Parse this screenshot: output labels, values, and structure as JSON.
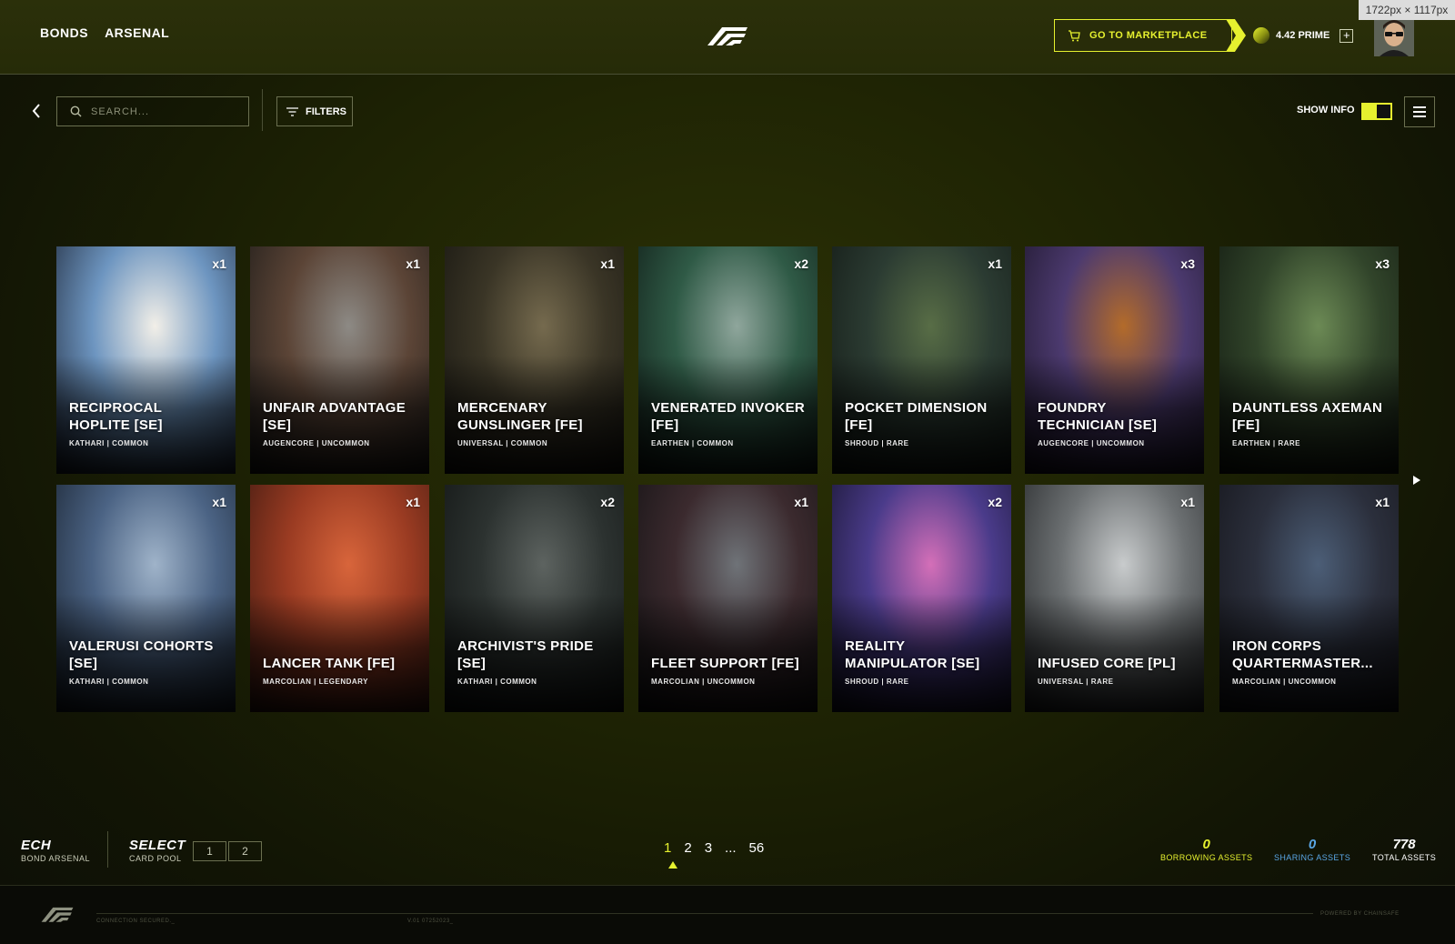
{
  "nav": {
    "bonds": "BONDS",
    "arsenal": "ARSENAL"
  },
  "header": {
    "marketplace_label": "GO TO MARKETPLACE",
    "prime_value": "4.42 PRIME",
    "plus": "+",
    "dimension_badge": "1722px × 1117px"
  },
  "toolbar": {
    "search_placeholder": "SEARCH...",
    "filters_label": "FILTERS",
    "show_info_label": "SHOW INFO"
  },
  "colors": {
    "accent": "#e6f12f",
    "sharing": "#5aa7e6",
    "bg": "#1d2204"
  },
  "cards": [
    {
      "count": "x1",
      "name": "RECIPROCAL HOPLITE [SE]",
      "meta": "KATHARI | COMMON",
      "art": [
        "#f2efe8",
        "#6d95c0",
        "#1a2232"
      ]
    },
    {
      "count": "x1",
      "name": "UNFAIR ADVANTAGE [SE]",
      "meta": "AUGENCORE | UNCOMMON",
      "art": [
        "#8d8a85",
        "#5b4436",
        "#1b1a18"
      ]
    },
    {
      "count": "x1",
      "name": "MERCENARY GUNSLINGER [FE]",
      "meta": "UNIVERSAL | COMMON",
      "art": [
        "#756a4e",
        "#3a3526",
        "#15140f"
      ]
    },
    {
      "count": "x2",
      "name": "VENERATED INVOKER [FE]",
      "meta": "EARTHEN | COMMON",
      "art": [
        "#8fa69c",
        "#2f5a46",
        "#0f1a15"
      ]
    },
    {
      "count": "x1",
      "name": "POCKET DIMENSION [FE]",
      "meta": "SHROUD | RARE",
      "art": [
        "#586d46",
        "#2b3b32",
        "#121814"
      ]
    },
    {
      "count": "x3",
      "name": "FOUNDRY TECHNICIAN [SE]",
      "meta": "AUGENCORE | UNCOMMON",
      "art": [
        "#b36b2a",
        "#4c3a6f",
        "#1a1426"
      ]
    },
    {
      "count": "x3",
      "name": "DAUNTLESS AXEMAN [FE]",
      "meta": "EARTHEN | RARE",
      "art": [
        "#6c8a55",
        "#31442a",
        "#111810"
      ]
    },
    {
      "count": "x1",
      "name": "VALERUSI COHORTS [SE]",
      "meta": "KATHARI | COMMON",
      "art": [
        "#9fb3c9",
        "#4b6384",
        "#17202c"
      ]
    },
    {
      "count": "x1",
      "name": "LANCER TANK [FE]",
      "meta": "MARCOLIAN | LEGENDARY",
      "art": [
        "#d8653b",
        "#9a3b22",
        "#3a1810"
      ]
    },
    {
      "count": "x2",
      "name": "ARCHIVIST'S PRIDE [SE]",
      "meta": "KATHARI | COMMON",
      "art": [
        "#5d6360",
        "#2c3230",
        "#111413"
      ]
    },
    {
      "count": "x1",
      "name": "FLEET SUPPORT [FE]",
      "meta": "MARCOLIAN | UNCOMMON",
      "art": [
        "#6f7378",
        "#3b2a2e",
        "#131214"
      ]
    },
    {
      "count": "x2",
      "name": "REALITY MANIPULATOR [SE]",
      "meta": "SHROUD | RARE",
      "art": [
        "#d46fb8",
        "#4a3b8a",
        "#141228"
      ]
    },
    {
      "count": "x1",
      "name": "INFUSED CORE [PL]",
      "meta": "UNIVERSAL | RARE",
      "art": [
        "#c8cbcc",
        "#6c7072",
        "#222426"
      ]
    },
    {
      "count": "x1",
      "name": "IRON CORPS QUARTERMASTER...",
      "meta": "MARCOLIAN | UNCOMMON",
      "art": [
        "#4c5e77",
        "#2b2f3c",
        "#141419"
      ]
    }
  ],
  "bottom": {
    "ech": "ECH",
    "ech_sub": "BOND ARSENAL",
    "select": "SELECT",
    "select_sub": "CARD POOL",
    "pool_1": "1",
    "pool_2": "2",
    "pages": [
      "1",
      "2",
      "3",
      "...",
      "56"
    ],
    "borrowing_num": "0",
    "borrowing_lbl": "BORROWING ASSETS",
    "sharing_num": "0",
    "sharing_lbl": "SHARING ASSETS",
    "total_num": "778",
    "total_lbl": "TOTAL ASSETS"
  },
  "footer": {
    "connection": "CONNECTION SECURED._",
    "version": "V.01 07252023_",
    "powered": "POWERED BY CHAINSAFE"
  }
}
